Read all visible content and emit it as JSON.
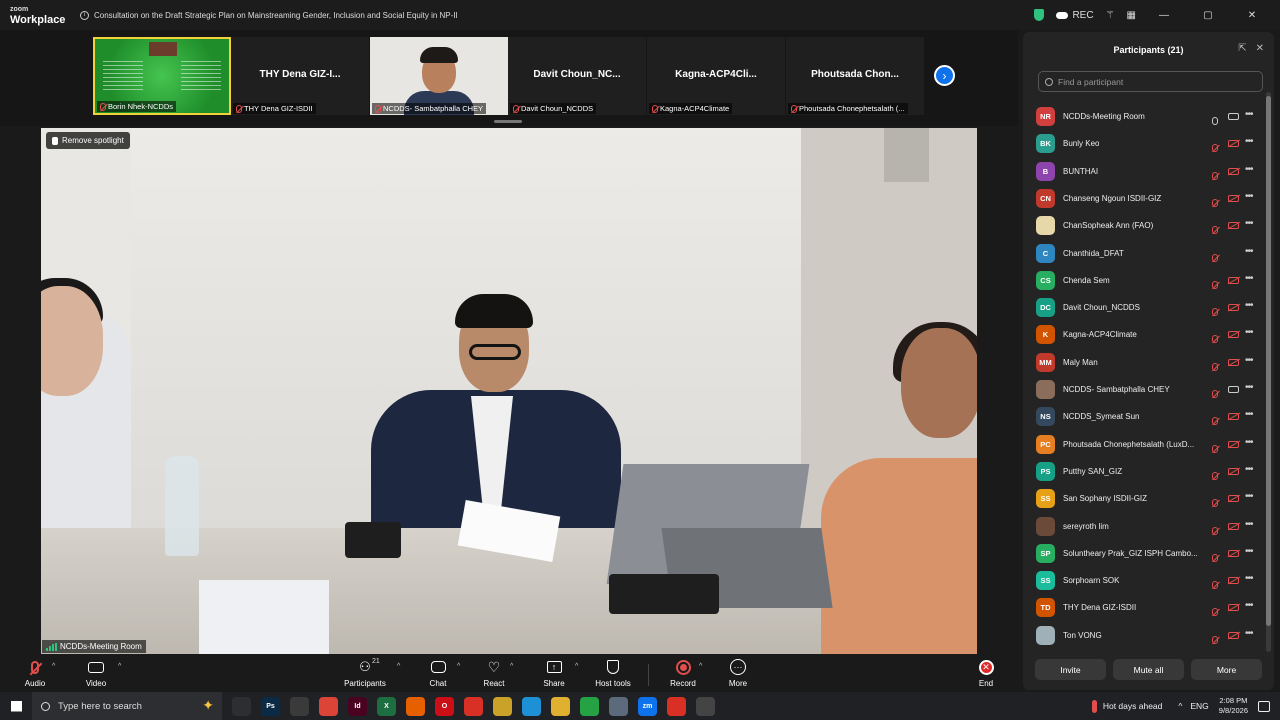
{
  "app": {
    "logo_top": "zoom",
    "logo_bottom": "Workplace",
    "meeting_title": "Consultation on the Draft Strategic Plan on Mainstreaming Gender, Inclusion and Social Equity in NP-II",
    "rec_label": "REC",
    "brand_blue": "#0e72ed",
    "muted_red": "#e24d4d"
  },
  "filmstrip": [
    {
      "display": "",
      "label": "Borin Nhek-NCDDs",
      "type": "slide"
    },
    {
      "display": "THY Dena GIZ-I...",
      "label": "THY Dena GIZ-ISDII",
      "type": "name"
    },
    {
      "display": "",
      "label": "NCDDS- Sambatphalla CHEY",
      "type": "face"
    },
    {
      "display": "Davit  Choun_NC...",
      "label": "Davit Choun_NCDDS",
      "type": "name"
    },
    {
      "display": "Kagna-ACP4Cli...",
      "label": "Kagna-ACP4Climate",
      "type": "name"
    },
    {
      "display": "Phoutsada  Chon...",
      "label": "Phoutsada Chonephetsalath (...",
      "type": "name"
    }
  ],
  "main_video": {
    "spotlight_label": "Remove spotlight",
    "name_label": "NCDDs-Meeting Room"
  },
  "participants_panel": {
    "title": "Participants (21)",
    "search_placeholder": "Find a participant",
    "invite_label": "Invite",
    "mute_all_label": "Mute all",
    "more_label": "More",
    "list": [
      {
        "initials": "NR",
        "name": "NCDDs-Meeting Room",
        "color": "#d13f3f",
        "mic": "on",
        "video": "on"
      },
      {
        "initials": "BK",
        "name": "Bunly Keo",
        "color": "#2a9d8f",
        "mic": "off",
        "video": "off"
      },
      {
        "initials": "B",
        "name": "BUNTHAI",
        "color": "#8e44ad",
        "mic": "off",
        "video": "off"
      },
      {
        "initials": "CN",
        "name": "Chanseng Ngoun ISDII-GIZ",
        "color": "#c0392b",
        "mic": "off",
        "video": "off"
      },
      {
        "initials": "",
        "name": "ChanSopheak Ann (FAO)",
        "color": "#e6d8a8",
        "mic": "off",
        "video": "off"
      },
      {
        "initials": "C",
        "name": "Chanthida_DFAT",
        "color": "#2e86c1",
        "mic": "off",
        "video": "none"
      },
      {
        "initials": "CS",
        "name": "Chenda Sem",
        "color": "#27ae60",
        "mic": "off",
        "video": "off"
      },
      {
        "initials": "DC",
        "name": "Davit Choun_NCDDS",
        "color": "#16a085",
        "mic": "off",
        "video": "off"
      },
      {
        "initials": "K",
        "name": "Kagna-ACP4Climate",
        "color": "#d35400",
        "mic": "off",
        "video": "off"
      },
      {
        "initials": "MM",
        "name": "Maly Man",
        "color": "#c0392b",
        "mic": "off",
        "video": "off"
      },
      {
        "initials": "",
        "name": "NCDDS- Sambatphalla CHEY",
        "color": "#8a6d5a",
        "mic": "off",
        "video": "on"
      },
      {
        "initials": "NS",
        "name": "NCDDS_Symeat Sun",
        "color": "#34495e",
        "mic": "off",
        "video": "off"
      },
      {
        "initials": "PC",
        "name": "Phoutsada Chonephetsalath (LuxD...",
        "color": "#e67e22",
        "mic": "off",
        "video": "off"
      },
      {
        "initials": "PS",
        "name": "Putthy SAN_GIZ",
        "color": "#16a085",
        "mic": "off",
        "video": "off"
      },
      {
        "initials": "SS",
        "name": "San Sophany ISDII-GIZ",
        "color": "#e6a117",
        "mic": "off",
        "video": "off"
      },
      {
        "initials": "",
        "name": "sereyroth lim",
        "color": "#6b4a3a",
        "mic": "off",
        "video": "off"
      },
      {
        "initials": "SP",
        "name": "Soluntheary Prak_GIZ ISPH Cambo...",
        "color": "#27ae60",
        "mic": "off",
        "video": "off"
      },
      {
        "initials": "SS",
        "name": "Sorphoarn SOK",
        "color": "#1abc9c",
        "mic": "off",
        "video": "off"
      },
      {
        "initials": "TD",
        "name": "THY Dena GIZ-ISDII",
        "color": "#d35400",
        "mic": "off",
        "video": "off"
      },
      {
        "initials": "",
        "name": "Ton VONG",
        "color": "#9fb0b8",
        "mic": "off",
        "video": "off"
      }
    ]
  },
  "toolbar": {
    "audio": "Audio",
    "video": "Video",
    "participants": "Participants",
    "participants_count": "21",
    "chat": "Chat",
    "react": "React",
    "share": "Share",
    "host_tools": "Host tools",
    "record": "Record",
    "more": "More",
    "end": "End"
  },
  "taskbar": {
    "search_placeholder": "Type here to search",
    "weather": "Hot days ahead",
    "language": "ENG",
    "time": "2:08 PM",
    "date": "9/8/2026",
    "apps": [
      {
        "label": "",
        "color": "#2d2e31",
        "icon": "task-view-icon"
      },
      {
        "label": "Ps",
        "color": "#0b2a45",
        "icon": "photoshop-icon"
      },
      {
        "label": "",
        "color": "#3a3a3a",
        "icon": "snipping-tool-icon"
      },
      {
        "label": "",
        "color": "#db4437",
        "icon": "chrome-icon"
      },
      {
        "label": "Id",
        "color": "#49021f",
        "icon": "indesign-icon"
      },
      {
        "label": "X",
        "color": "#1d6f42",
        "icon": "excel-icon"
      },
      {
        "label": "",
        "color": "#e66000",
        "icon": "firefox-icon"
      },
      {
        "label": "O",
        "color": "#cc0f16",
        "icon": "opera-icon"
      },
      {
        "label": "",
        "color": "#d93025",
        "icon": "acrobat-icon"
      },
      {
        "label": "",
        "color": "#c9a227",
        "icon": "archive-icon"
      },
      {
        "label": "",
        "color": "#1e90d6",
        "icon": "telegram-icon"
      },
      {
        "label": "",
        "color": "#e0b030",
        "icon": "folder-icon"
      },
      {
        "label": "",
        "color": "#25a244",
        "icon": "app-green-icon"
      },
      {
        "label": "",
        "color": "#5b6b7b",
        "icon": "app-gray-icon"
      },
      {
        "label": "zm",
        "color": "#0e72ed",
        "icon": "zoom-icon"
      },
      {
        "label": "",
        "color": "#d93025",
        "icon": "app-red-icon"
      },
      {
        "label": "",
        "color": "#444",
        "icon": "app-dark-icon"
      }
    ]
  }
}
